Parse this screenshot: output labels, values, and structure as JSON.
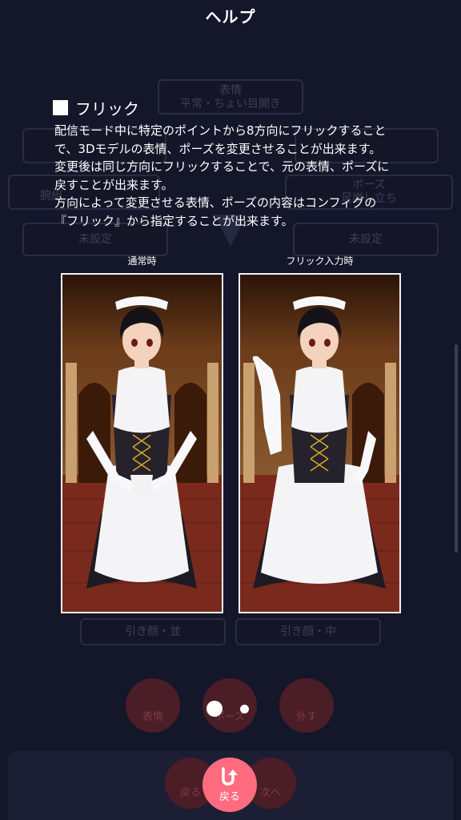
{
  "header": {
    "title": "ヘルプ"
  },
  "background": {
    "top_box_label": "表情",
    "top_box_value": "平常・ちょい目開き",
    "left_cut": "腕組",
    "right_box_label": "ポーズ",
    "right_box_value": "足崩し立ち",
    "unset_left": "未設定",
    "unset_right": "未設定",
    "bottom_left_value": "引き顔・並",
    "bottom_right_value": "引き顔・中",
    "circle_expression": "表情",
    "circle_pose": "ポーズ",
    "circle_remove": "外す",
    "back_ghost": "戻る",
    "next_ghost": "次へ"
  },
  "section": {
    "heading": "フリック",
    "lines": [
      "配信モード中に特定のポイントから8方向にフリックすること",
      "で、3Dモデルの表情、ポーズを変更させることが出来ます。",
      "変更後は同じ方向にフリックすることで、元の表情、ポーズに",
      "戻すことが出来ます。",
      "方向によって変更させる表情、ポーズの内容はコンフィグの",
      "『フリック』から指定することが出来ます。"
    ]
  },
  "images": {
    "normal_label": "通常時",
    "flick_label": "フリック入力時"
  },
  "pager": {
    "pages": 2,
    "current": 1
  },
  "footer": {
    "back_label": "戻る"
  },
  "colors": {
    "accent": "#ff6c80",
    "background": "#14162a",
    "ghost_red": "#4a1d27"
  }
}
